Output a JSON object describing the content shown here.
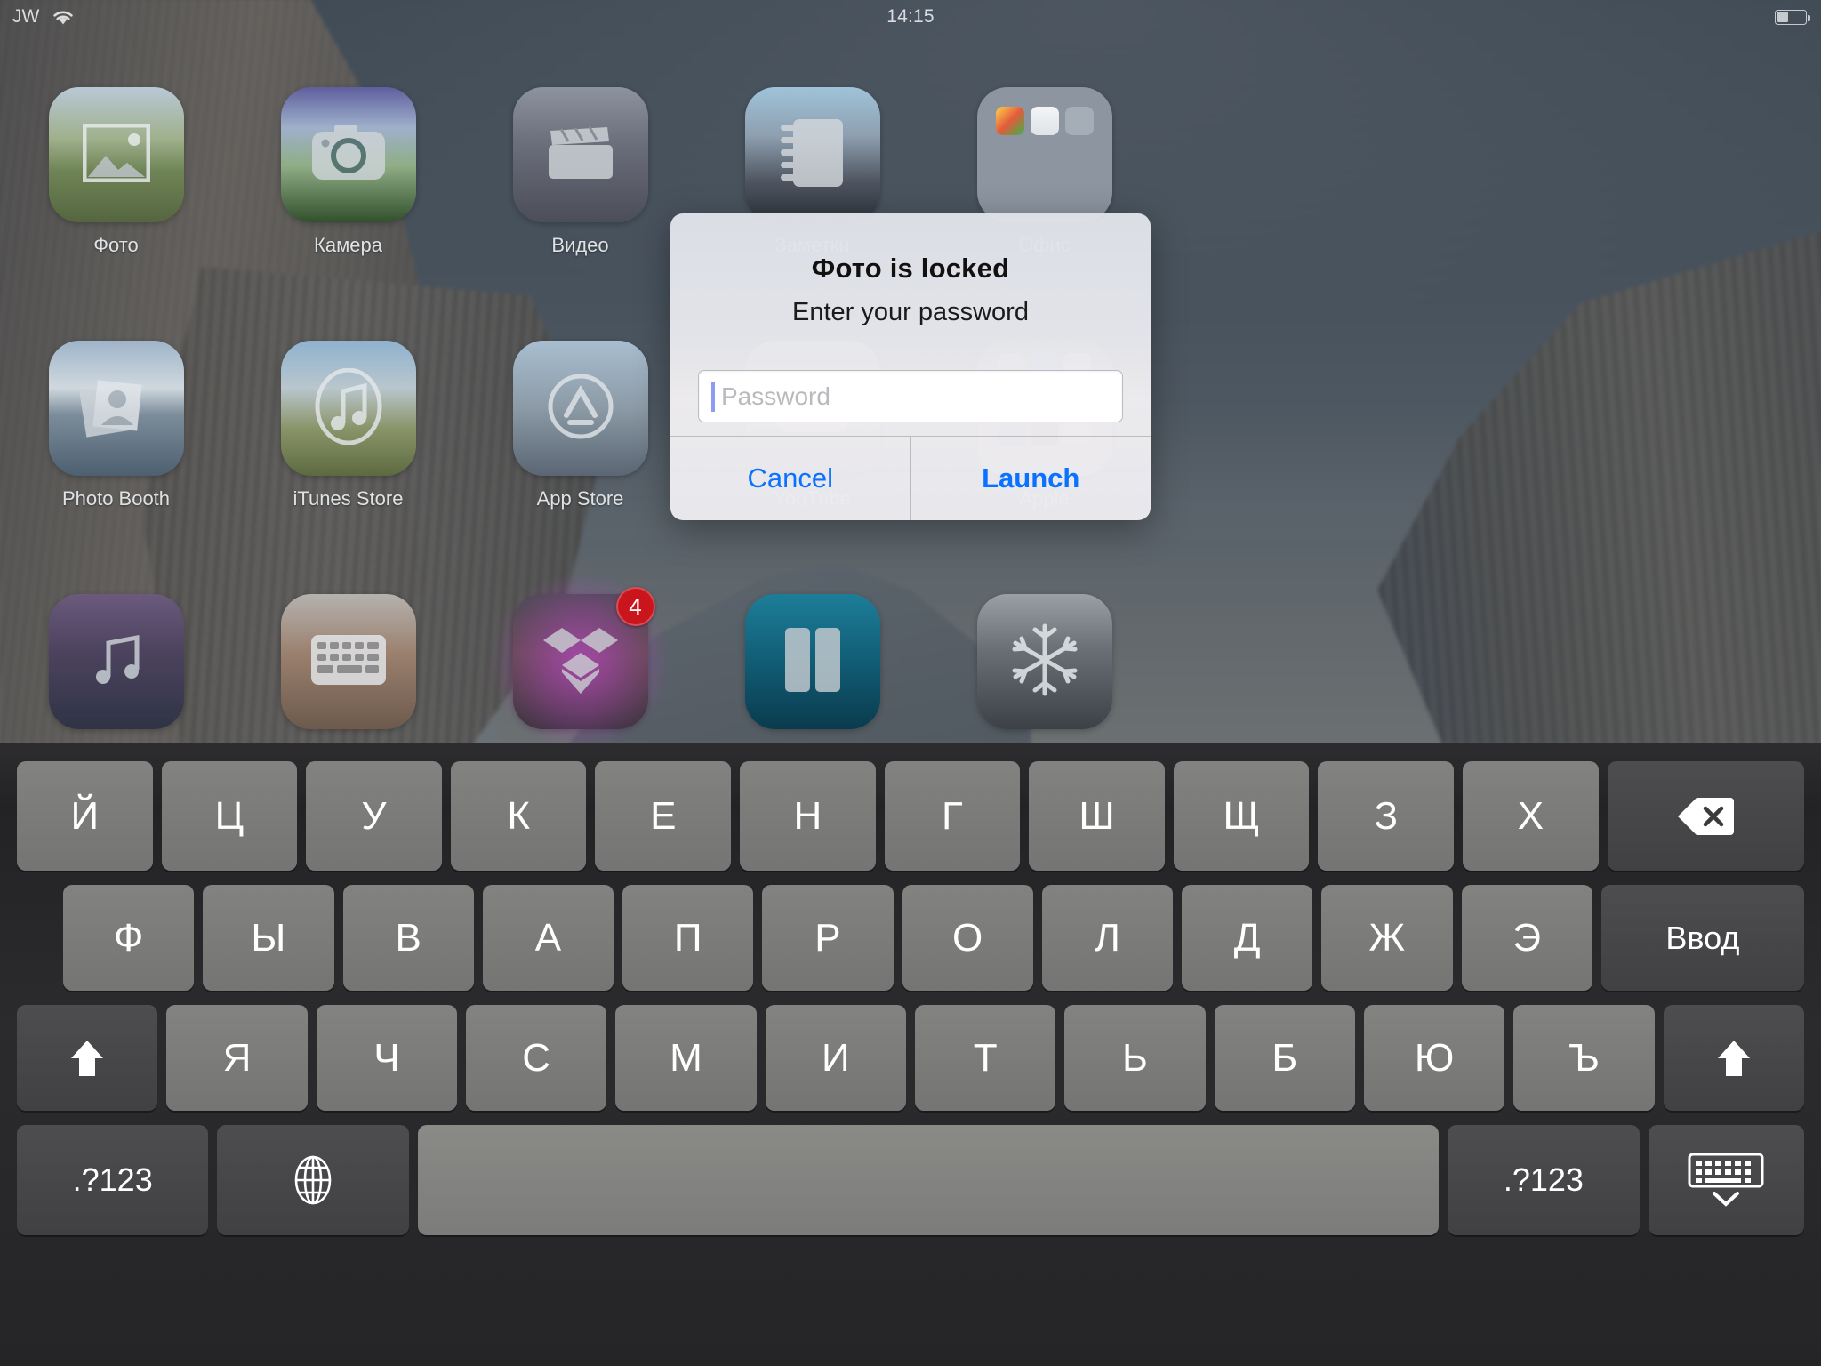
{
  "status_bar": {
    "carrier": "JW",
    "wifi_icon": "wifi-icon",
    "time": "14:15",
    "battery_icon": "battery-icon",
    "battery_level_pct": 38
  },
  "home_screen": {
    "rows": [
      [
        {
          "label": "Фото",
          "icon": "photos-icon",
          "tile": "bg-photos",
          "badge": null
        },
        {
          "label": "Камера",
          "icon": "camera-icon",
          "tile": "bg-camera",
          "badge": null
        },
        {
          "label": "Видео",
          "icon": "videos-icon",
          "tile": "bg-videos",
          "badge": null
        },
        {
          "label": "Заметки",
          "icon": "notes-icon",
          "tile": "bg-notes",
          "badge": null
        },
        {
          "label": "Офис",
          "icon": "folder-icon",
          "tile": "bg-folder",
          "badge": null
        }
      ],
      [
        {
          "label": "Photo Booth",
          "icon": "photo-booth-icon",
          "tile": "bg-booth",
          "badge": null
        },
        {
          "label": "iTunes Store",
          "icon": "itunes-store-icon",
          "tile": "bg-itunes",
          "badge": null
        },
        {
          "label": "App Store",
          "icon": "app-store-icon",
          "tile": "bg-appstore",
          "badge": null
        },
        {
          "label": "YouTube",
          "icon": "youtube-icon",
          "tile": "bg-youtube",
          "badge": null
        },
        {
          "label": "Apple",
          "icon": "folder-icon",
          "tile": "bg-apple",
          "badge": null
        }
      ],
      [
        {
          "label": "",
          "icon": "music-icon",
          "tile": "bg-music",
          "badge": null
        },
        {
          "label": "",
          "icon": "keyboard-app-icon",
          "tile": "bg-keyb",
          "badge": null
        },
        {
          "label": "",
          "icon": "dropbox-icon",
          "tile": "bg-dropbox",
          "badge": "4"
        },
        {
          "label": "",
          "icon": "ibooks-icon",
          "tile": "bg-ibooks",
          "badge": null
        },
        {
          "label": "",
          "icon": "snowflake-icon",
          "tile": "bg-snow",
          "badge": null
        }
      ]
    ]
  },
  "alert": {
    "title": "Фото is locked",
    "message": "Enter your password",
    "password_placeholder": "Password",
    "password_value": "",
    "cancel_label": "Cancel",
    "launch_label": "Launch",
    "accent_color": "#0b72ff"
  },
  "keyboard": {
    "language": "Russian",
    "row1": [
      "Й",
      "Ц",
      "У",
      "К",
      "Е",
      "Н",
      "Г",
      "Ш",
      "Щ",
      "З",
      "Х"
    ],
    "row1_action": {
      "label": "",
      "icon": "backspace-icon"
    },
    "row2": [
      "Ф",
      "Ы",
      "В",
      "А",
      "П",
      "Р",
      "О",
      "Л",
      "Д",
      "Ж",
      "Э"
    ],
    "row2_action": {
      "label": "Ввод",
      "icon": "return-icon"
    },
    "row3": [
      "Я",
      "Ч",
      "С",
      "М",
      "И",
      "Т",
      "Ь",
      "Б",
      "Ю",
      "Ъ"
    ],
    "row3_shift_left": {
      "label": "",
      "icon": "shift-icon"
    },
    "row3_shift_right": {
      "label": "",
      "icon": "shift-icon"
    },
    "row4": {
      "numeric_left": ".?123",
      "globe": {
        "label": "",
        "icon": "globe-icon"
      },
      "space": {
        "label": "",
        "icon": "space-key"
      },
      "numeric_right": ".?123",
      "hide": {
        "label": "",
        "icon": "hide-keyboard-icon"
      }
    }
  }
}
